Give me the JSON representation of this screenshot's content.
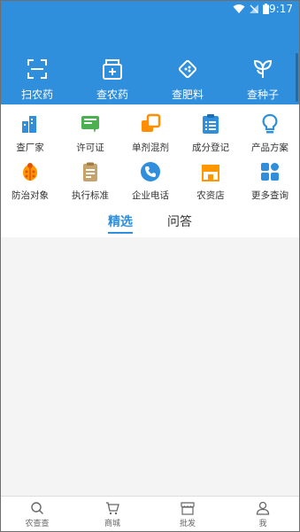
{
  "status_bar": {
    "time": "9:17"
  },
  "quick_actions": [
    {
      "label": "扫农药",
      "icon": "scan-icon"
    },
    {
      "label": "查农药",
      "icon": "medicine-box-icon"
    },
    {
      "label": "查肥料",
      "icon": "fertilizer-icon"
    },
    {
      "label": "查种子",
      "icon": "seedling-icon"
    }
  ],
  "grid": [
    {
      "label": "查厂家",
      "icon": "factory-icon",
      "color": "#2f8fdc"
    },
    {
      "label": "许可证",
      "icon": "license-icon",
      "color": "#4caf50"
    },
    {
      "label": "单剂混剂",
      "icon": "mix-icon",
      "color": "#ff8f00"
    },
    {
      "label": "成分登记",
      "icon": "clipboard-icon",
      "color": "#2f8fdc"
    },
    {
      "label": "产品方案",
      "icon": "lightbulb-icon",
      "color": "#2f8fdc"
    },
    {
      "label": "防治对象",
      "icon": "bug-icon",
      "color": "#ff9800"
    },
    {
      "label": "执行标准",
      "icon": "document-icon",
      "color": "#c8a26b"
    },
    {
      "label": "企业电话",
      "icon": "phone-icon",
      "color": "#2f8fdc"
    },
    {
      "label": "农资店",
      "icon": "store-icon",
      "color": "#ff9800"
    },
    {
      "label": "更多查询",
      "icon": "more-grid-icon",
      "color": "#2f8fdc"
    }
  ],
  "tabs": [
    {
      "label": "精选",
      "active": true
    },
    {
      "label": "问答",
      "active": false
    }
  ],
  "bottom_nav": [
    {
      "label": "农查查",
      "icon": "search-icon"
    },
    {
      "label": "商城",
      "icon": "cart-icon"
    },
    {
      "label": "批发",
      "icon": "shop-icon"
    },
    {
      "label": "我",
      "icon": "user-icon"
    }
  ],
  "colors": {
    "primary": "#2f8fdc",
    "background": "#f4f4f4"
  }
}
